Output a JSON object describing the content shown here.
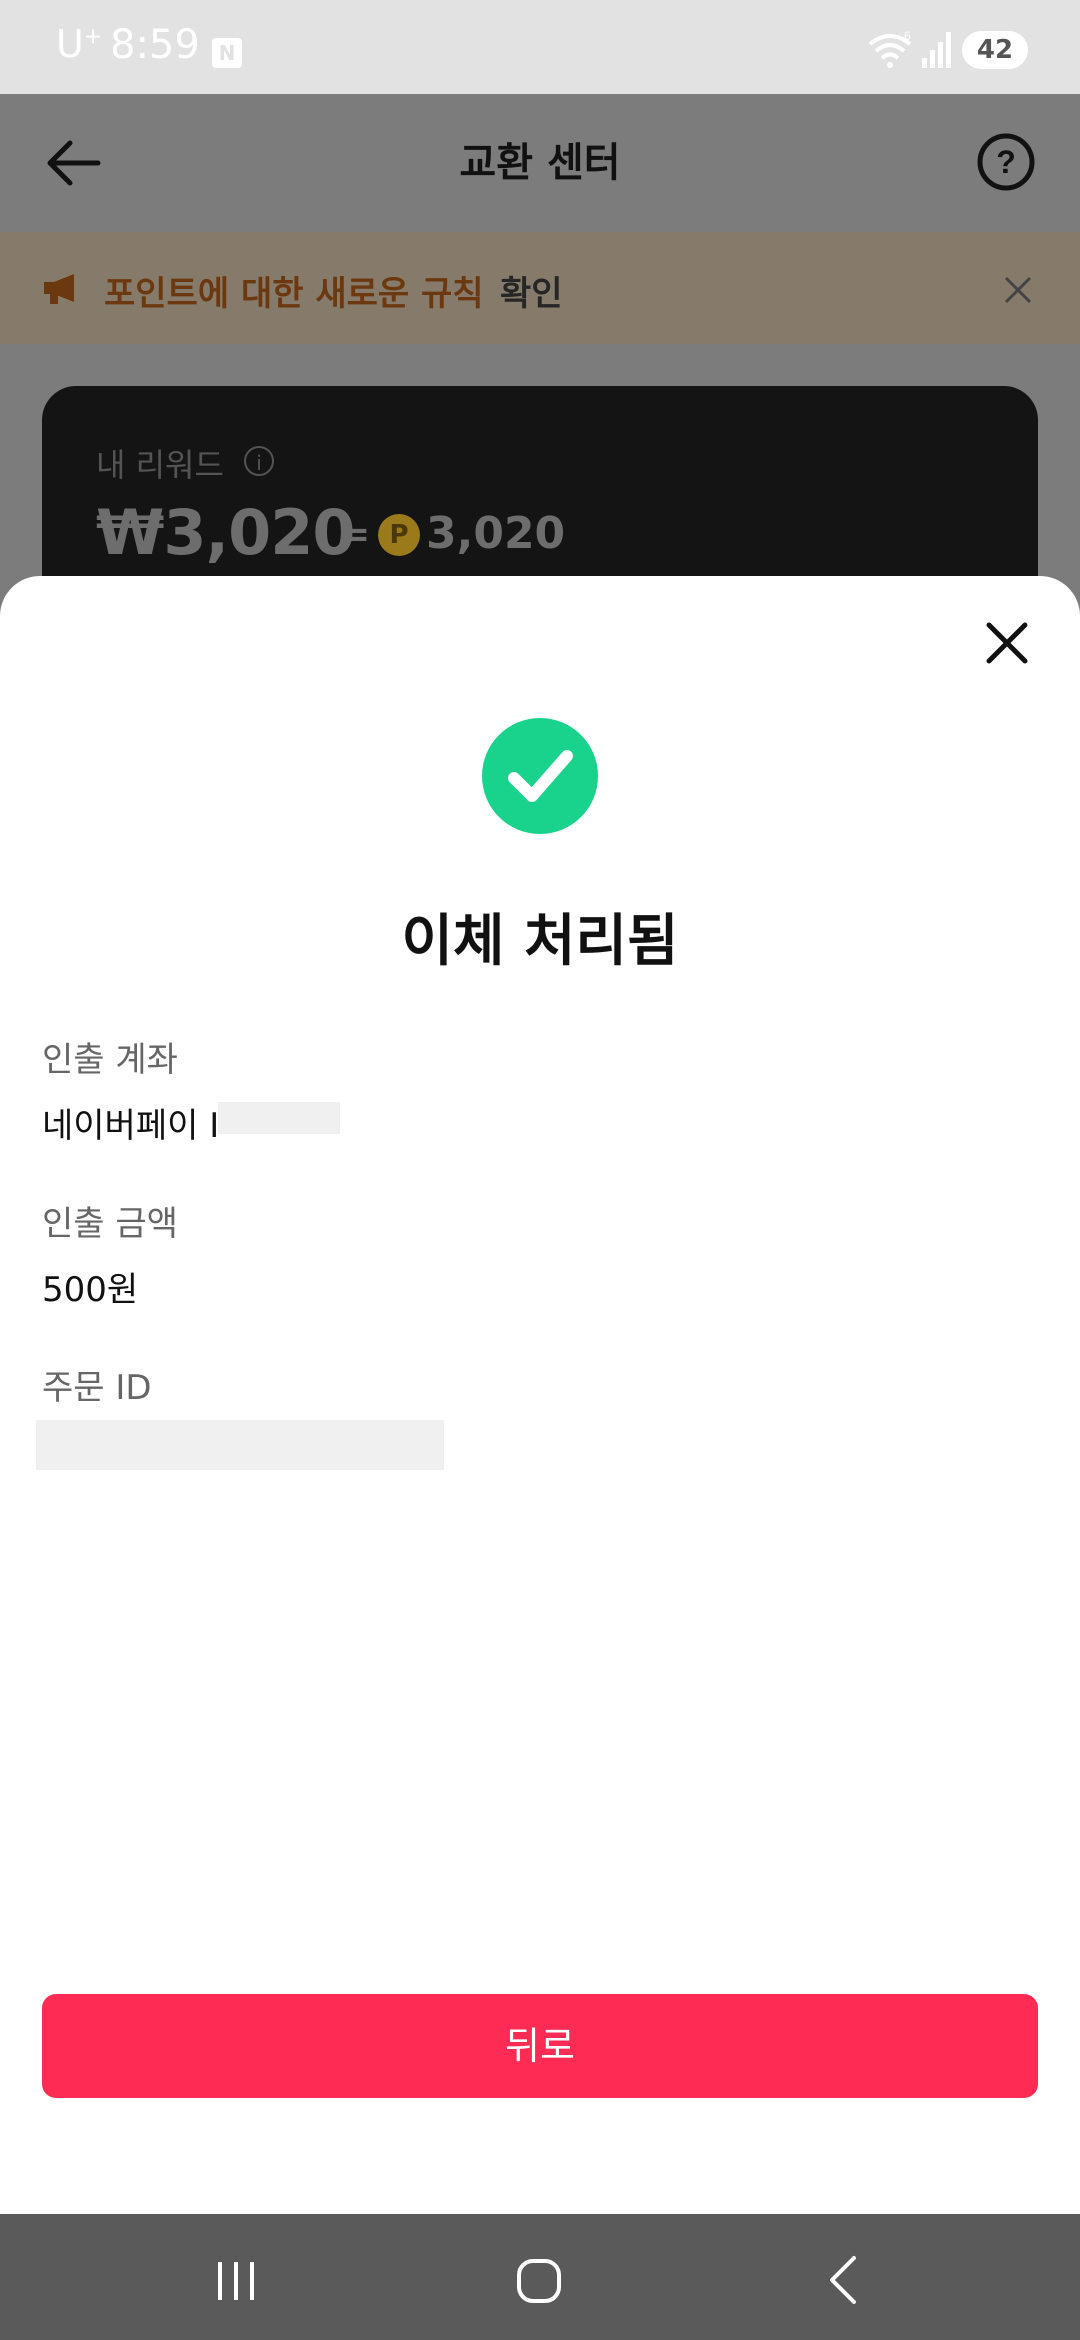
{
  "status_bar": {
    "carrier": "U",
    "carrier_sup": "+",
    "time": "8:59",
    "notification_badge": "N",
    "wifi_label": "6",
    "battery": "42"
  },
  "header": {
    "title": "교환 센터",
    "back_icon": "arrow-left-icon",
    "help_icon": "question-circle-icon"
  },
  "notice": {
    "text": "포인트에 대한 새로운 규칙",
    "link": "확인",
    "icon": "megaphone-icon"
  },
  "reward_card": {
    "label": "내 리워드",
    "amount": "₩3,020",
    "equals": "=",
    "coin_letter": "P",
    "points": "3,020"
  },
  "sheet": {
    "title": "이체 처리됨",
    "fields": [
      {
        "label": "인출 계좌",
        "value": "네이버페이 I"
      },
      {
        "label": "인출 금액",
        "value": "500원"
      },
      {
        "label": "주문 ID",
        "value": ""
      }
    ],
    "back_button": "뒤로"
  },
  "colors": {
    "accent": "#fe2c55",
    "success": "#19d38c"
  }
}
